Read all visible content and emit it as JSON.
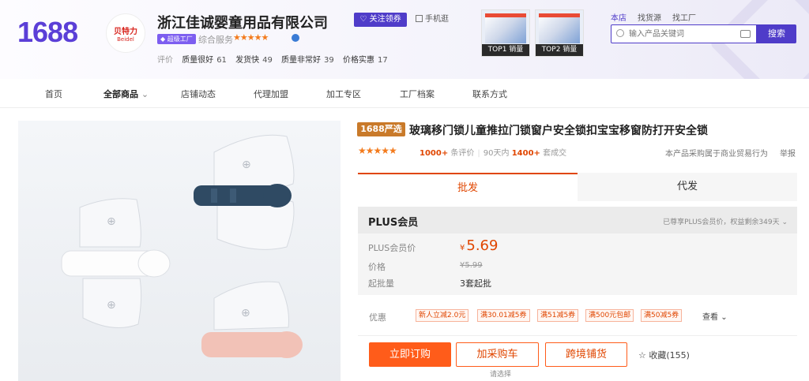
{
  "header": {
    "logo": "1688",
    "shop_badge_title": "贝特力",
    "shop_badge_sub": "Beidel",
    "shop_name": "浙江佳诚婴童用品有限公司",
    "factory_tag": "超级工厂",
    "service_label": "综合服务",
    "service_stars": "★★★★★",
    "ratings_label": "评价",
    "ratings": [
      {
        "k": "质量很好",
        "v": "61"
      },
      {
        "k": "发货快",
        "v": "49"
      },
      {
        "k": "质量非常好",
        "v": "39"
      },
      {
        "k": "价格实惠",
        "v": "17"
      }
    ],
    "follow_label": "关注领券",
    "mobile_label": "手机逛",
    "top1_label": "TOP1 销量",
    "top2_label": "TOP2 销量",
    "search_tabs": [
      "本店",
      "找货源",
      "找工厂"
    ],
    "search_placeholder": "输入产品关键词",
    "search_button": "搜索"
  },
  "nav": {
    "items": [
      "首页",
      "全部商品",
      "店铺动态",
      "代理加盟",
      "加工专区",
      "工厂档案",
      "联系方式"
    ]
  },
  "product": {
    "badge": "1688严选",
    "title": "玻璃移门锁儿童推拉门锁窗户安全锁扣宝宝移窗防打开安全锁",
    "stars": "★★★★★",
    "reviews_count": "1000+",
    "reviews_label": "条评价",
    "days_label": "90天内",
    "sold_count": "1400+",
    "sold_label": "套成交",
    "biz_note": "本产品采购属于商业贸易行为",
    "report": "举报"
  },
  "tabs": {
    "wholesale": "批发",
    "dropship": "代发"
  },
  "price": {
    "plus_title": "PLUS会员",
    "plus_note": "已尊享PLUS会员价，权益剩余349天",
    "plus_price_label": "PLUS会员价",
    "currency": "¥",
    "plus_price": "5.69",
    "price_label": "价格",
    "original_price": "¥5.99",
    "moq_label": "起批量",
    "moq": "3套起批"
  },
  "discounts": {
    "label": "优惠",
    "coupons": [
      "新人立减2.0元",
      "满30.01减5券",
      "满51减5券",
      "满500元包邮",
      "满50减5券"
    ],
    "view_more": "查看"
  },
  "actions": {
    "buy_now": "立即订购",
    "add_cart": "加采购车",
    "cross_border": "跨境铺货",
    "choose_hint": "请选择",
    "favorite": "收藏(155)"
  }
}
